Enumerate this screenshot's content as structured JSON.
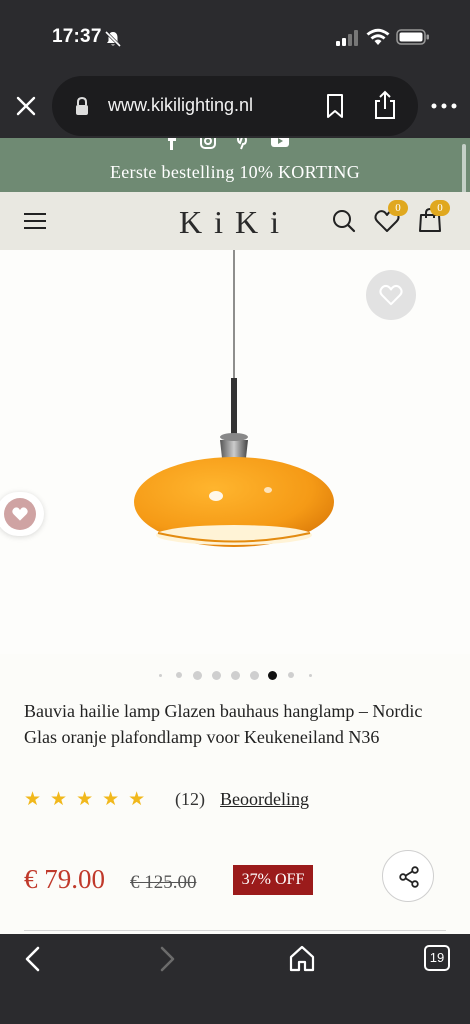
{
  "status": {
    "time": "17:37"
  },
  "browser": {
    "url": "www.kikilighting.nl",
    "tab_count": "19"
  },
  "promo": {
    "text": "Eerste bestelling 10% KORTING"
  },
  "header": {
    "logo": "KiKi",
    "wishlist_count": "0",
    "cart_count": "0"
  },
  "gallery": {
    "total_images": 9,
    "active_index": 6
  },
  "product": {
    "title": "Bauvia hailie lamp Glazen bauhaus hanglamp – Nordic Glas oranje plafondlamp voor Keukeneiland N36",
    "stars": "★★★★★",
    "rating_value": 5,
    "rating_count": "(12)",
    "rating_link": "Beoordeling",
    "price": "€ 79.00",
    "old_price": "€ 125.00",
    "discount": "37% OFF"
  },
  "colors": {
    "promo_bg": "#6f8a73",
    "price": "#c0392b",
    "discount_bg": "#9b1b1b",
    "star": "#f1b81c",
    "badge": "#e0a81f",
    "lamp": "#f39a1d"
  }
}
